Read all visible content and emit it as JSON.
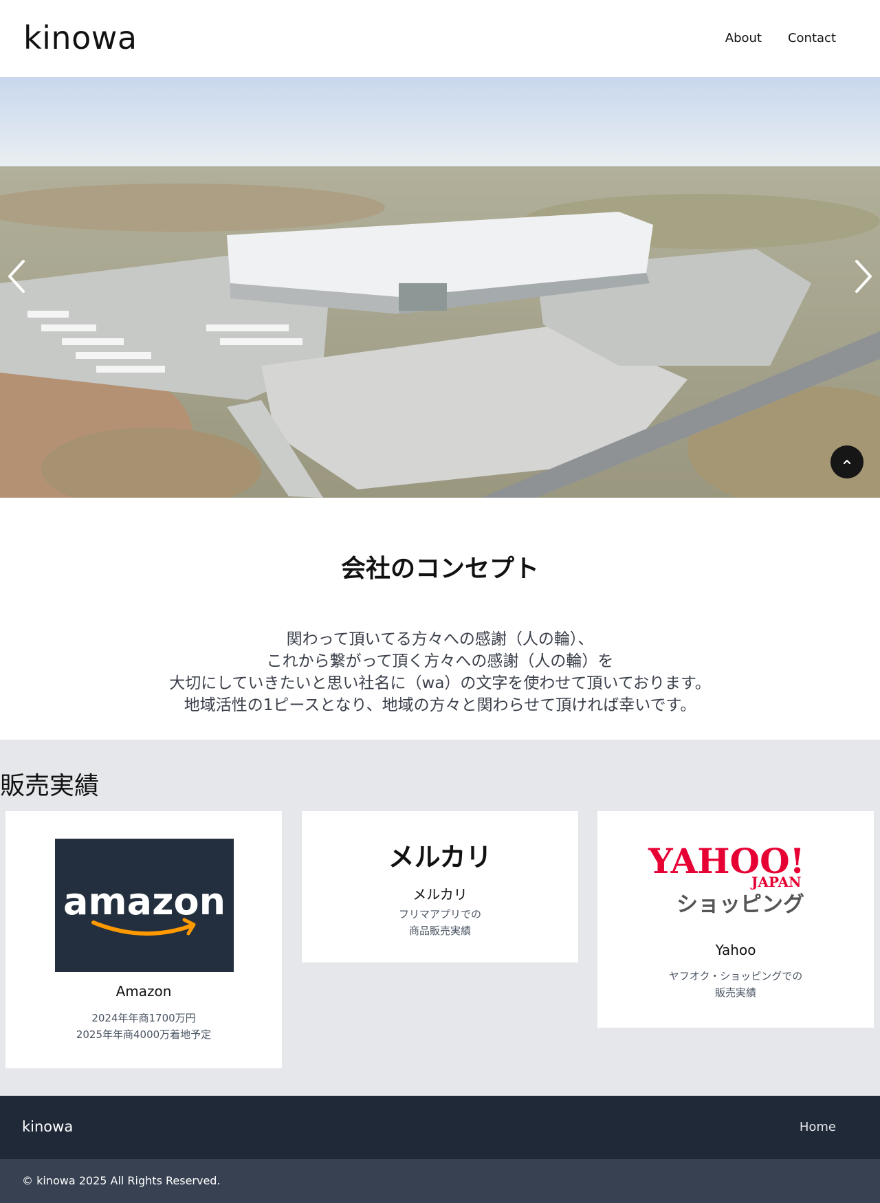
{
  "header": {
    "logo": "kinowa",
    "nav": [
      {
        "label": "About"
      },
      {
        "label": "Contact"
      }
    ]
  },
  "hero": {
    "icons": [
      "chevron-left-icon",
      "chevron-right-icon",
      "chevron-up-icon"
    ]
  },
  "concept": {
    "title": "会社のコンセプト",
    "lines": [
      "関わって頂いてる方々への感謝（人の輪）、",
      "これから繋がって頂く方々への感謝（人の輪）を",
      "大切にしていきたいと思い社名に（wa）の文字を使わせて頂いております。",
      "地域活性の1ピースとなり、地域の方々と関わらせて頂ければ幸いです。"
    ]
  },
  "sales": {
    "title": "販売実績",
    "cards": [
      {
        "logo_text": "amazon",
        "name": "Amazon",
        "desc": [
          "2024年年商1700万円",
          "2025年年商4000万着地予定"
        ]
      },
      {
        "logo_text": "メルカリ",
        "name": "メルカリ",
        "desc": [
          "フリマアプリでの",
          "商品販売実績"
        ]
      },
      {
        "logo_text": "YAHOO!",
        "logo_sub": "JAPAN",
        "logo_shop": "ショッピング",
        "name": "Yahoo",
        "desc": [
          "ヤフオク・ショッピングでの",
          "販売実績"
        ]
      }
    ]
  },
  "footer": {
    "logo": "kinowa",
    "home": "Home",
    "copyright": "© kinowa 2025 All Rights Reserved."
  },
  "colors": {
    "footer_bg": "#1f2937",
    "copyright_bg": "#374151",
    "sales_bg": "#e5e7eb",
    "amazon_bg": "#232f3e",
    "amazon_smile": "#ff9900",
    "yahoo_red": "#e60033",
    "yahoo_gray": "#555555"
  }
}
